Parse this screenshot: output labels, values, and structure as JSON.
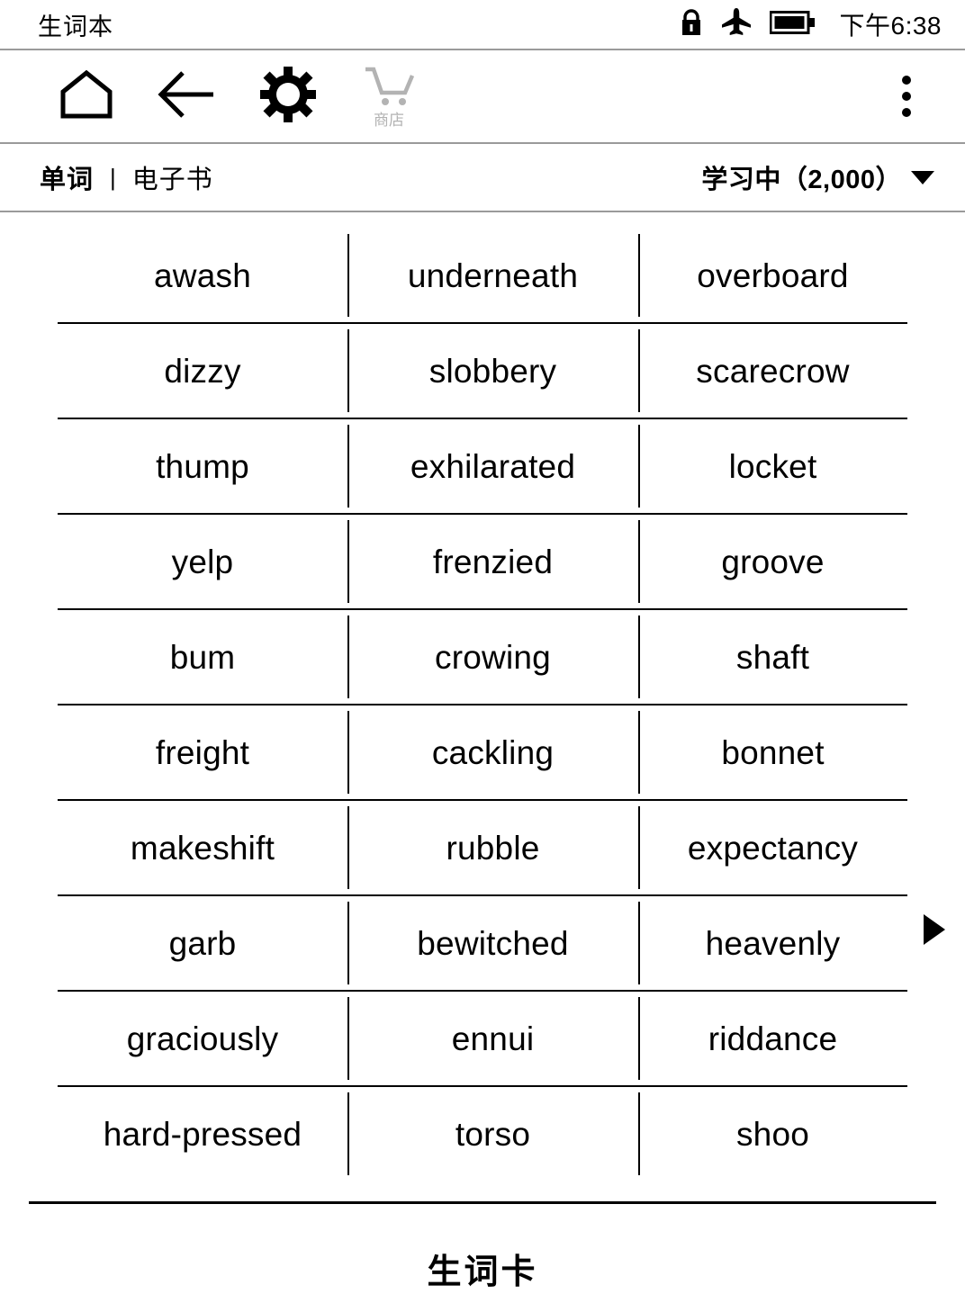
{
  "statusbar": {
    "title": "生词本",
    "time": "下午6:38",
    "icons": [
      "lock-icon",
      "airplane-mode-icon",
      "battery-icon"
    ]
  },
  "toolbar": {
    "buttons": [
      {
        "name": "home-icon",
        "label": ""
      },
      {
        "name": "back-arrow-icon",
        "label": ""
      },
      {
        "name": "settings-gear-icon",
        "label": ""
      },
      {
        "name": "shop-cart-icon",
        "label": "商店"
      }
    ],
    "overflow": "overflow-menu-icon"
  },
  "tabs": {
    "items": [
      {
        "label": "单词",
        "active": true
      },
      {
        "label": "电子书",
        "active": false
      }
    ],
    "separator": "|",
    "filter": {
      "label": "学习中（2,000）",
      "count": "2,000",
      "caret": "▼"
    }
  },
  "grid": {
    "columns": 3,
    "rows": [
      [
        "awash",
        "underneath",
        "overboard"
      ],
      [
        "dizzy",
        "slobbery",
        "scarecrow"
      ],
      [
        "thump",
        "exhilarated",
        "locket"
      ],
      [
        "yelp",
        "frenzied",
        "groove"
      ],
      [
        "bum",
        "crowing",
        "shaft"
      ],
      [
        "freight",
        "cackling",
        "bonnet"
      ],
      [
        "makeshift",
        "rubble",
        "expectancy"
      ],
      [
        "garb",
        "bewitched",
        "heavenly"
      ],
      [
        "graciously",
        "ennui",
        "riddance"
      ],
      [
        "hard-pressed",
        "torso",
        "shoo"
      ]
    ]
  },
  "pagination": {
    "next": "next-page-arrow"
  },
  "footer": {
    "label": "生词卡"
  },
  "colors": {
    "text": "#000000",
    "rule_gray": "#9a9a9a",
    "disabled": "#b3b3b3",
    "background": "#ffffff"
  }
}
